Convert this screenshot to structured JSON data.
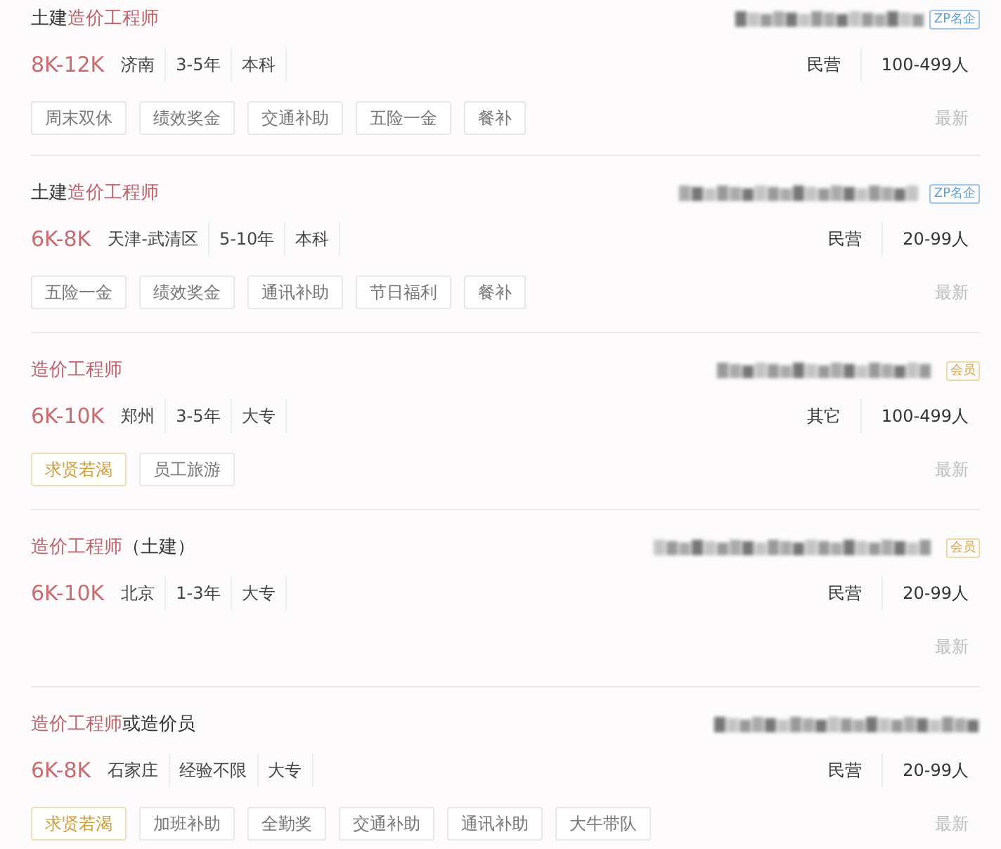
{
  "jobs": [
    {
      "title": [
        {
          "text": "土建",
          "highlight": false
        },
        {
          "text": "造价工程师",
          "highlight": true
        }
      ],
      "badge": {
        "text": "ZP名企",
        "kind": "brand"
      },
      "salary": "8K-12K",
      "meta": [
        "济南",
        "3-5年",
        "本科"
      ],
      "company_meta": [
        "民营",
        "100-499人"
      ],
      "tags": [
        {
          "text": "周末双休",
          "highlight": false
        },
        {
          "text": "绩效奖金",
          "highlight": false
        },
        {
          "text": "交通补助",
          "highlight": false
        },
        {
          "text": "五险一金",
          "highlight": false
        },
        {
          "text": "餐补",
          "highlight": false
        }
      ],
      "status": "最新"
    },
    {
      "title": [
        {
          "text": "土建",
          "highlight": false
        },
        {
          "text": "造价工程师",
          "highlight": true
        }
      ],
      "badge": {
        "text": "ZP名企",
        "kind": "brand"
      },
      "salary": "6K-8K",
      "meta": [
        "天津-武清区",
        "5-10年",
        "本科"
      ],
      "company_meta": [
        "民营",
        "20-99人"
      ],
      "tags": [
        {
          "text": "五险一金",
          "highlight": false
        },
        {
          "text": "绩效奖金",
          "highlight": false
        },
        {
          "text": "通讯补助",
          "highlight": false
        },
        {
          "text": "节日福利",
          "highlight": false
        },
        {
          "text": "餐补",
          "highlight": false
        }
      ],
      "status": "最新"
    },
    {
      "title": [
        {
          "text": "造价工程师",
          "highlight": true
        }
      ],
      "badge": {
        "text": "会员",
        "kind": "member"
      },
      "salary": "6K-10K",
      "meta": [
        "郑州",
        "3-5年",
        "大专"
      ],
      "company_meta": [
        "其它",
        "100-499人"
      ],
      "tags": [
        {
          "text": "求贤若渴",
          "highlight": true
        },
        {
          "text": "员工旅游",
          "highlight": false
        }
      ],
      "status": "最新"
    },
    {
      "title": [
        {
          "text": "造价工程师",
          "highlight": true
        },
        {
          "text": "（土建）",
          "highlight": false
        }
      ],
      "badge": {
        "text": "会员",
        "kind": "member"
      },
      "salary": "6K-10K",
      "meta": [
        "北京",
        "1-3年",
        "大专"
      ],
      "company_meta": [
        "民营",
        "20-99人"
      ],
      "status": "最新"
    },
    {
      "title": [
        {
          "text": "造价工程师",
          "highlight": true
        },
        {
          "text": "或造价员",
          "highlight": false
        }
      ],
      "salary": "6K-8K",
      "meta": [
        "石家庄",
        "经验不限",
        "大专"
      ],
      "company_meta": [
        "民营",
        "20-99人"
      ],
      "tags": [
        {
          "text": "求贤若渴",
          "highlight": true
        },
        {
          "text": "加班补助",
          "highlight": false
        },
        {
          "text": "全勤奖",
          "highlight": false
        },
        {
          "text": "交通补助",
          "highlight": false
        },
        {
          "text": "通讯补助",
          "highlight": false
        },
        {
          "text": "大牛带队",
          "highlight": false
        }
      ],
      "status": "最新"
    }
  ]
}
